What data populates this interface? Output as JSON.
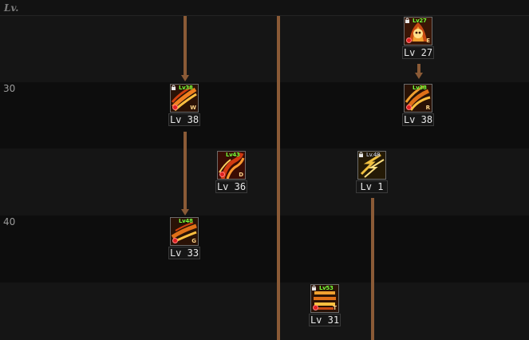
{
  "header": {
    "lv_label": "Lv."
  },
  "level_markers": [
    "30",
    "40"
  ],
  "skills": [
    {
      "name": "skill-e",
      "level_text": "Lv 27",
      "req_text": "Lv27",
      "hotkey": "E",
      "locked": true
    },
    {
      "name": "skill-w",
      "level_text": "Lv 38",
      "req_text": "Lv38",
      "hotkey": "W",
      "locked": true
    },
    {
      "name": "skill-r",
      "level_text": "Lv 38",
      "req_text": "Lv38",
      "hotkey": "R",
      "locked": false
    },
    {
      "name": "skill-d",
      "level_text": "Lv 36",
      "req_text": "Lv43",
      "hotkey": "D",
      "locked": false
    },
    {
      "name": "skill-passive",
      "level_text": "Lv 1",
      "req_text": "Lv.48",
      "hotkey": "",
      "locked": true
    },
    {
      "name": "skill-g",
      "level_text": "Lv 33",
      "req_text": "Lv48",
      "hotkey": "G",
      "locked": false
    },
    {
      "name": "skill-t",
      "level_text": "Lv 31",
      "req_text": "Lv53",
      "hotkey": "T",
      "locked": true
    }
  ],
  "colors": {
    "connector": "#8a5a36",
    "required_level": "#7cff3a",
    "alert": "#e02020"
  }
}
